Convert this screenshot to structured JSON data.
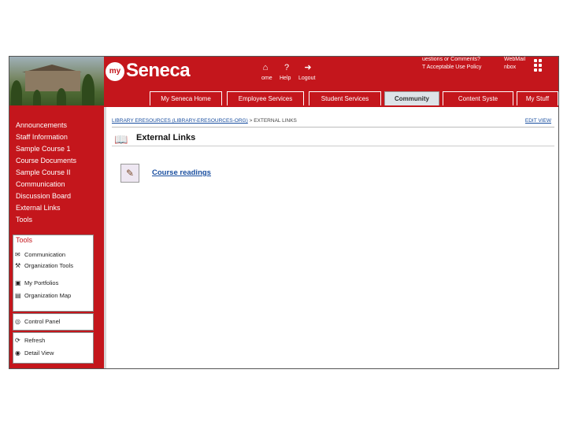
{
  "header": {
    "logo_prefix": "my",
    "logo_name": "Seneca",
    "icons": [
      {
        "icon": "home-icon",
        "label": "ome"
      },
      {
        "icon": "help-icon",
        "label": "Help"
      },
      {
        "icon": "logout-icon",
        "label": "Logout"
      }
    ],
    "top_links": [
      "uestions or Comments?",
      "T Acceptable Use Policy"
    ],
    "webmail": [
      "WebMail",
      "nbox"
    ]
  },
  "tabs": [
    {
      "label": "My Seneca Home",
      "active": false
    },
    {
      "label": "Employee Services",
      "active": false
    },
    {
      "label": "Student Services",
      "active": false
    },
    {
      "label": "Community",
      "active": true
    },
    {
      "label": "Content Syste",
      "active": false
    },
    {
      "label": "My Stuff",
      "active": false
    }
  ],
  "sidebar": {
    "links": [
      "Announcements",
      "Staff Information",
      "Sample Course 1",
      "Course Documents",
      "Sample Course II",
      "Communication",
      "Discussion Board",
      "External Links",
      "Tools"
    ],
    "tools_box": {
      "title": "Tools",
      "items": [
        {
          "icon": "communication-icon",
          "label": "Communication"
        },
        {
          "icon": "organization-tools-icon",
          "label": "Organization Tools"
        },
        {
          "icon": "portfolio-icon",
          "label": "My Portfolios"
        },
        {
          "icon": "organization-map-icon",
          "label": "Organization Map"
        }
      ]
    },
    "control_box": {
      "items": [
        {
          "icon": "control-panel-icon",
          "label": "Control Panel"
        }
      ]
    },
    "view_box": {
      "items": [
        {
          "icon": "refresh-icon",
          "label": "Refresh"
        },
        {
          "icon": "detail-view-icon",
          "label": "Detail View"
        }
      ]
    }
  },
  "content": {
    "breadcrumb": {
      "link": "LIBRARY ERESOURCES (LIBRARY-ERESOURCES-ORG)",
      "separator": " > ",
      "current": "EXTERNAL LINKS"
    },
    "edit_view": "EDIT VIEW",
    "title": "External Links",
    "items": [
      {
        "icon": "external-link-icon",
        "label": "Course readings"
      }
    ]
  },
  "colors": {
    "brand": "#c4161c",
    "link": "#1a4fa0"
  }
}
